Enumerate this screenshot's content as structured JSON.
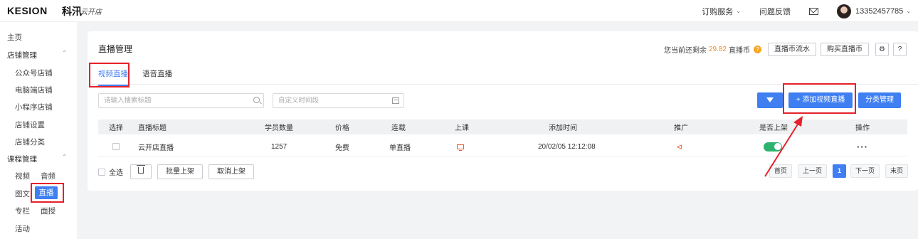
{
  "topbar": {
    "logo": "KESION",
    "logo_cn": "科汛",
    "logo_script": "云开店",
    "order_service": "订购服务",
    "feedback": "问题反馈",
    "user_phone": "13352457785"
  },
  "sidebar": {
    "home": "主页",
    "shop_mgmt": "店铺管理",
    "shop_items": [
      "公众号店铺",
      "电脑端店铺",
      "小程序店铺",
      "店铺设置",
      "店铺分类"
    ],
    "course_mgmt": "课程管理",
    "video": "视频",
    "audio": "音频",
    "article": "图文",
    "live": "直播",
    "column": "专栏",
    "offline": "面授",
    "activity": "活动"
  },
  "main": {
    "title": "直播管理",
    "balance_prefix": "您当前还剩余",
    "balance_amount": "29.82",
    "balance_unit": "直播币",
    "btn_coin_flow": "直播币流水",
    "btn_buy_coin": "购买直播币",
    "help": "?",
    "tabs": [
      "视频直播",
      "语音直播"
    ],
    "search_placeholder": "请输入搜索标题",
    "date_placeholder": "自定义时间段",
    "btn_add_live": "+ 添加视频直播",
    "btn_category": "分类管理"
  },
  "table": {
    "headers": [
      "选择",
      "直播标题",
      "学员数量",
      "价格",
      "连载",
      "上课",
      "添加时间",
      "推广",
      "是否上架",
      "操作"
    ],
    "rows": [
      {
        "title": "云开店直播",
        "students": "1257",
        "price": "免费",
        "serial": "单直播",
        "time": "20/02/05 12:12:08",
        "actions": "···"
      }
    ]
  },
  "footer": {
    "select_all": "全选",
    "btn_batch_on": "批量上架",
    "btn_cancel_on": "取消上架"
  },
  "pager": {
    "first": "首页",
    "prev": "上一页",
    "current": "1",
    "next": "下一页",
    "last": "末页"
  }
}
